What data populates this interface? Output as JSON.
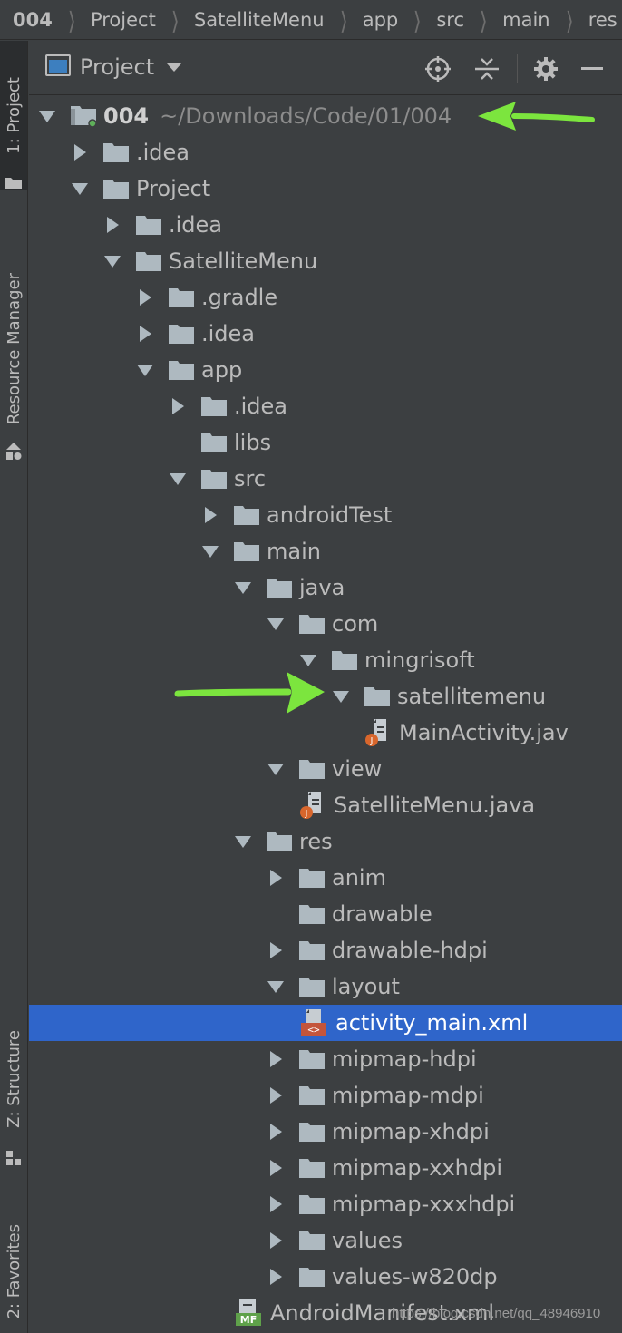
{
  "breadcrumb": [
    "004",
    "Project",
    "SatelliteMenu",
    "app",
    "src",
    "main",
    "res"
  ],
  "strip": {
    "tab_project": "1: Project",
    "tab_resource": "Resource Manager",
    "tab_structure": "Z: Structure",
    "tab_favorites": "2: Favorites"
  },
  "panel": {
    "title": "Project",
    "buttons": [
      "crosshair-icon",
      "collapse-all-icon",
      "gear-icon",
      "minimize-icon"
    ]
  },
  "tree": [
    {
      "name": "004",
      "path": "~/Downloads/Code/01/004",
      "depth": 0,
      "state": "expanded",
      "icon": "module-folder",
      "root": true
    },
    {
      "name": ".idea",
      "depth": 1,
      "state": "collapsed",
      "icon": "folder"
    },
    {
      "name": "Project",
      "depth": 1,
      "state": "expanded",
      "icon": "folder"
    },
    {
      "name": ".idea",
      "depth": 2,
      "state": "collapsed",
      "icon": "folder"
    },
    {
      "name": "SatelliteMenu",
      "depth": 2,
      "state": "expanded",
      "icon": "folder"
    },
    {
      "name": ".gradle",
      "depth": 3,
      "state": "collapsed",
      "icon": "folder"
    },
    {
      "name": ".idea",
      "depth": 3,
      "state": "collapsed",
      "icon": "folder"
    },
    {
      "name": "app",
      "depth": 3,
      "state": "expanded",
      "icon": "folder"
    },
    {
      "name": ".idea",
      "depth": 4,
      "state": "collapsed",
      "icon": "folder"
    },
    {
      "name": "libs",
      "depth": 4,
      "state": "leaf",
      "icon": "folder"
    },
    {
      "name": "src",
      "depth": 4,
      "state": "expanded",
      "icon": "folder"
    },
    {
      "name": "androidTest",
      "depth": 5,
      "state": "collapsed",
      "icon": "folder"
    },
    {
      "name": "main",
      "depth": 5,
      "state": "expanded",
      "icon": "folder"
    },
    {
      "name": "java",
      "depth": 6,
      "state": "expanded",
      "icon": "folder"
    },
    {
      "name": "com",
      "depth": 7,
      "state": "expanded",
      "icon": "folder"
    },
    {
      "name": "mingrisoft",
      "depth": 8,
      "state": "expanded",
      "icon": "folder"
    },
    {
      "name": "satellitemenu",
      "depth": 9,
      "state": "expanded",
      "icon": "folder"
    },
    {
      "name": "MainActivity.jav",
      "depth": 10,
      "state": "leaf",
      "icon": "java-file"
    },
    {
      "name": "view",
      "depth": 7,
      "state": "expanded",
      "icon": "folder"
    },
    {
      "name": "SatelliteMenu.java",
      "depth": 8,
      "state": "leaf",
      "icon": "java-file"
    },
    {
      "name": "res",
      "depth": 6,
      "state": "expanded",
      "icon": "folder"
    },
    {
      "name": "anim",
      "depth": 7,
      "state": "collapsed",
      "icon": "folder"
    },
    {
      "name": "drawable",
      "depth": 7,
      "state": "leaf",
      "icon": "folder"
    },
    {
      "name": "drawable-hdpi",
      "depth": 7,
      "state": "collapsed",
      "icon": "folder"
    },
    {
      "name": "layout",
      "depth": 7,
      "state": "expanded",
      "icon": "folder"
    },
    {
      "name": "activity_main.xml",
      "depth": 8,
      "state": "leaf",
      "icon": "xml-file",
      "selected": true
    },
    {
      "name": "mipmap-hdpi",
      "depth": 7,
      "state": "collapsed",
      "icon": "folder"
    },
    {
      "name": "mipmap-mdpi",
      "depth": 7,
      "state": "collapsed",
      "icon": "folder"
    },
    {
      "name": "mipmap-xhdpi",
      "depth": 7,
      "state": "collapsed",
      "icon": "folder"
    },
    {
      "name": "mipmap-xxhdpi",
      "depth": 7,
      "state": "collapsed",
      "icon": "folder"
    },
    {
      "name": "mipmap-xxxhdpi",
      "depth": 7,
      "state": "collapsed",
      "icon": "folder"
    },
    {
      "name": "values",
      "depth": 7,
      "state": "collapsed",
      "icon": "folder"
    },
    {
      "name": "values-w820dp",
      "depth": 7,
      "state": "collapsed",
      "icon": "folder"
    },
    {
      "name": "AndroidManifest.xml",
      "depth": 6,
      "state": "leaf",
      "icon": "manifest-file"
    }
  ],
  "watermark": "https://blog.csdn.net/qq_48946910",
  "colors": {
    "background": "#3c3f41",
    "selection": "#2f65ca",
    "folder": "#aeb9c0",
    "annotation_arrow": "#7ce53e",
    "java_badge": "#d8662c",
    "xml_badge": "#c4553b",
    "manifest_badge": "#5fa14a"
  }
}
